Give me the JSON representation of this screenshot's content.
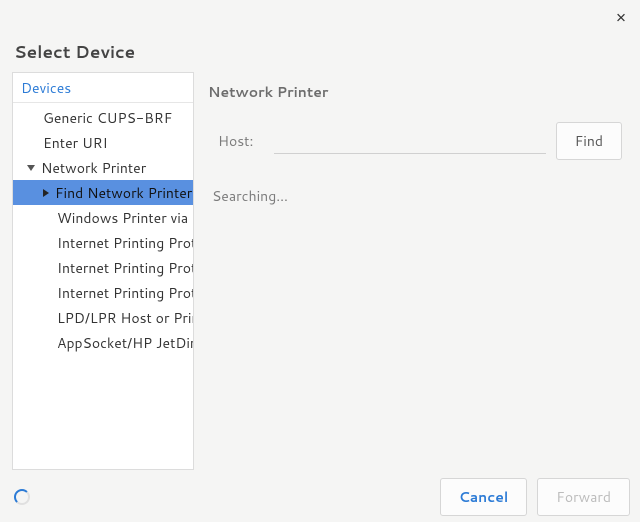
{
  "window": {
    "title": "Select Device",
    "close_icon": "×"
  },
  "sidebar": {
    "header": "Devices",
    "items": [
      {
        "label": "Generic CUPS-BRF",
        "level": "lvl1"
      },
      {
        "label": "Enter URI",
        "level": "lvl1"
      },
      {
        "label": "Network Printer",
        "level": "lvl1-exp",
        "expanded": true
      },
      {
        "label": "Find Network Printer",
        "level": "lvl2-sel",
        "selected": true,
        "child_arrow": true
      },
      {
        "label": "Windows Printer via SAMBA",
        "level": "lvl2"
      },
      {
        "label": "Internet Printing Protocol",
        "level": "lvl2"
      },
      {
        "label": "Internet Printing Protocol",
        "level": "lvl2"
      },
      {
        "label": "Internet Printing Protocol",
        "level": "lvl2"
      },
      {
        "label": "LPD/LPR Host or Printer",
        "level": "lvl2"
      },
      {
        "label": "AppSocket/HP JetDirect",
        "level": "lvl2"
      }
    ]
  },
  "main": {
    "section_title": "Network Printer",
    "host_label": "Host:",
    "host_value": "",
    "host_placeholder": "",
    "find_label": "Find",
    "status": "Searching..."
  },
  "footer": {
    "cancel_label": "Cancel",
    "forward_label": "Forward",
    "forward_enabled": false
  }
}
